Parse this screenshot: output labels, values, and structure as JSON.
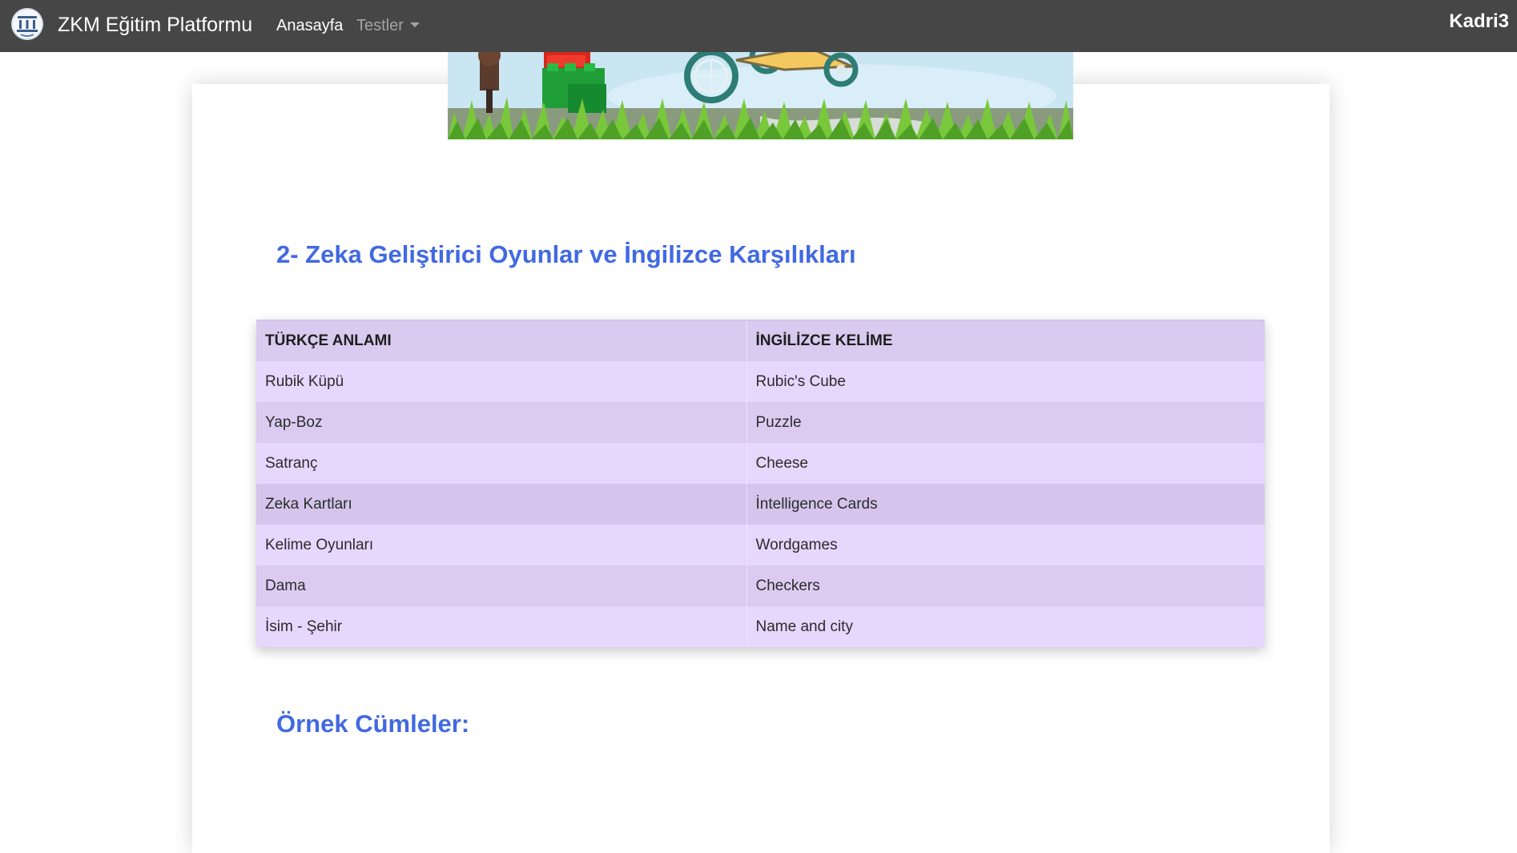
{
  "navbar": {
    "brand": "ZKM Eğitim Platformu",
    "links": [
      "Anasayfa",
      "Testler"
    ],
    "user": "Kadri3"
  },
  "section_title": "2- Zeka Geliştirici Oyunlar ve İngilizce Karşılıkları",
  "table": {
    "headers": [
      "TÜRKÇE ANLAMI",
      "İNGİLİZCE KELİME"
    ],
    "rows": [
      [
        "Rubik Küpü",
        "Rubic's Cube"
      ],
      [
        "Yap-Boz",
        "Puzzle"
      ],
      [
        "Satranç",
        "Cheese"
      ],
      [
        "Zeka Kartları",
        "İntelligence Cards"
      ],
      [
        "Kelime Oyunları",
        "Wordgames"
      ],
      [
        "Dama",
        "Checkers"
      ],
      [
        "İsim - Şehir",
        "Name and city"
      ]
    ]
  },
  "subsection_title": "Örnek Cümleler:",
  "colors": {
    "navbar": "#464646",
    "heading": "#4169e1",
    "table_header": "#d9caf0",
    "table_row_odd": "#e6d7fd",
    "table_row_even": "#dbcbf1"
  }
}
